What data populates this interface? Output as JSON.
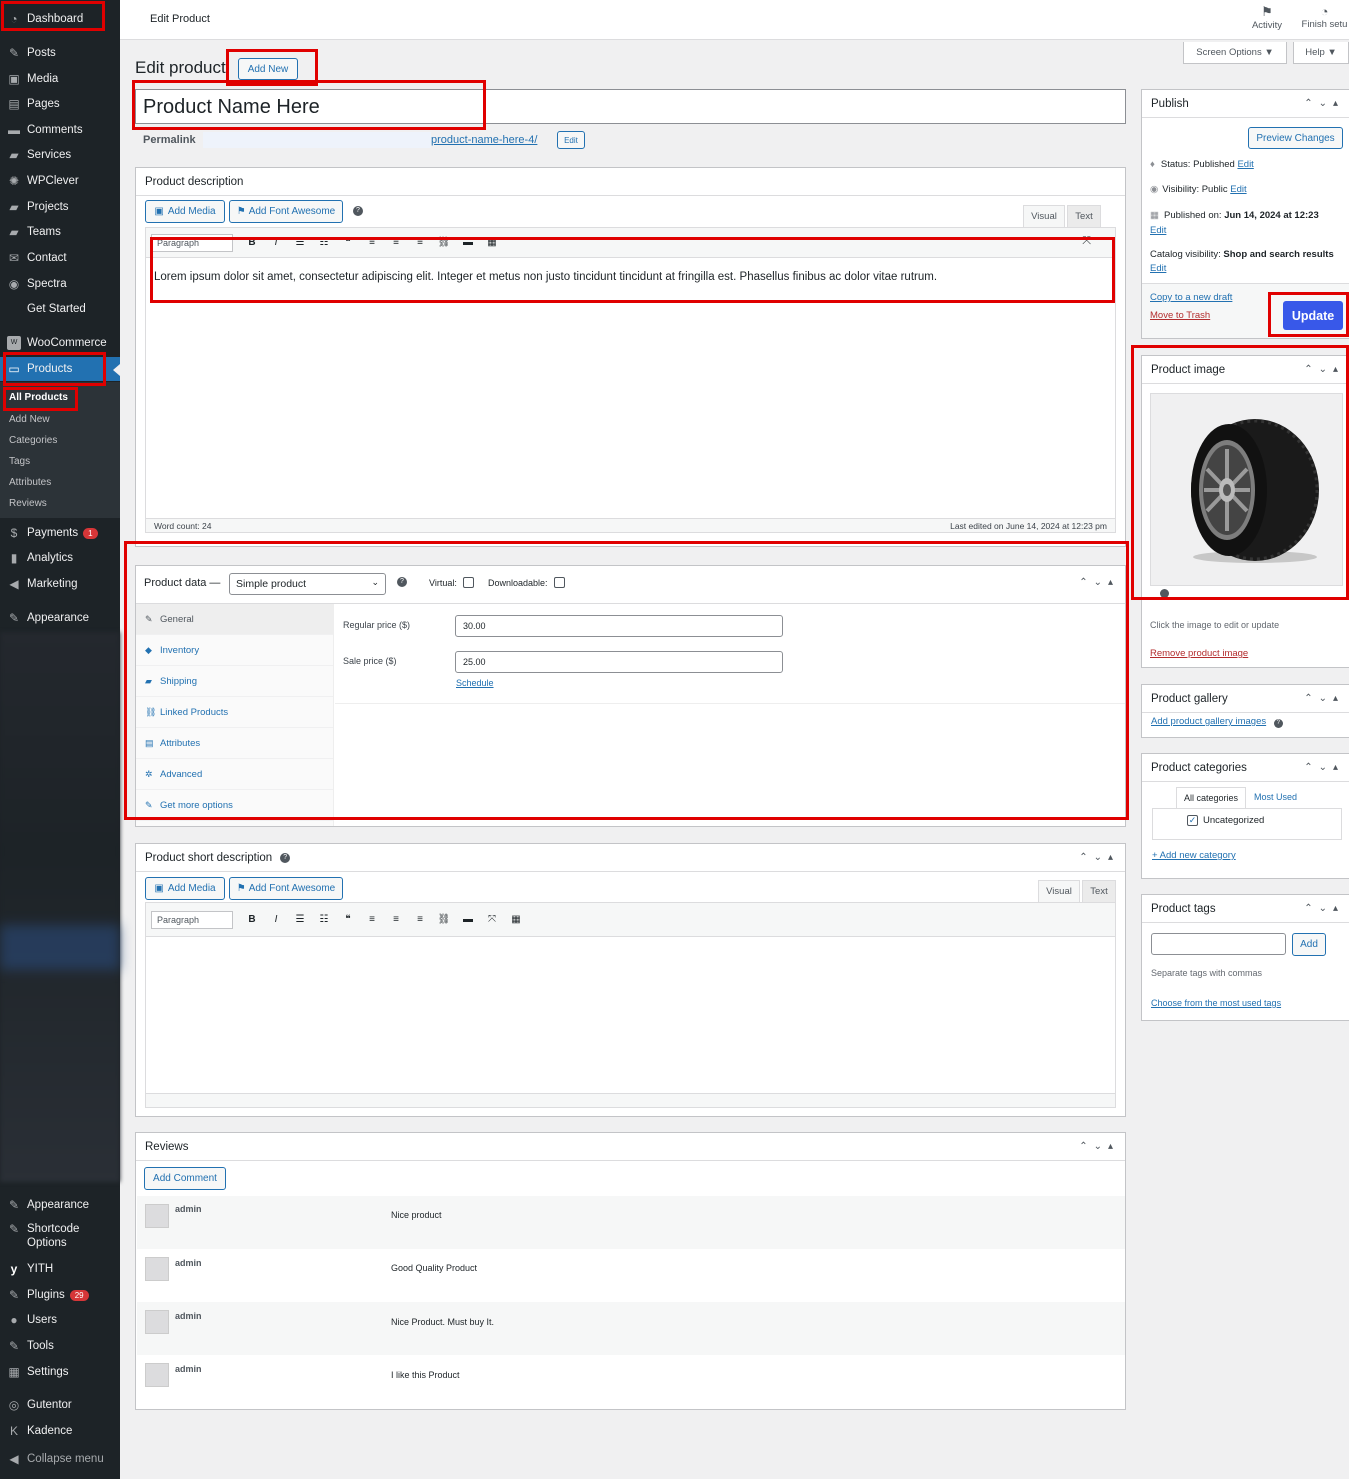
{
  "sidebar": {
    "items": [
      {
        "label": "Dashboard",
        "icon": "dashboard-icon"
      },
      {
        "label": "Posts",
        "icon": "pin-icon"
      },
      {
        "label": "Media",
        "icon": "media-icon"
      },
      {
        "label": "Pages",
        "icon": "pages-icon"
      },
      {
        "label": "Comments",
        "icon": "comment-icon"
      },
      {
        "label": "Services",
        "icon": "folder-icon"
      },
      {
        "label": "WPClever",
        "icon": "wpclever-icon"
      },
      {
        "label": "Projects",
        "icon": "folder-icon"
      },
      {
        "label": "Teams",
        "icon": "folder-icon"
      },
      {
        "label": "Contact",
        "icon": "mail-icon"
      },
      {
        "label": "Spectra",
        "icon": "spectra-icon"
      },
      {
        "label": "Get Started",
        "icon": ""
      },
      {
        "label": "WooCommerce",
        "icon": "woo-icon"
      },
      {
        "label": "Products",
        "icon": "products-icon"
      }
    ],
    "submenu": [
      "All Products",
      "Add New",
      "Categories",
      "Tags",
      "Attributes",
      "Reviews"
    ],
    "items2": [
      {
        "label": "Payments",
        "badge": "1"
      },
      {
        "label": "Analytics"
      },
      {
        "label": "Marketing"
      },
      {
        "label": "Appearance"
      }
    ],
    "items3": [
      {
        "label": "Appearance"
      },
      {
        "label": "Shortcode Options"
      },
      {
        "label": "YITH"
      },
      {
        "label": "Plugins",
        "badge": "29"
      },
      {
        "label": "Users"
      },
      {
        "label": "Tools"
      },
      {
        "label": "Settings"
      },
      {
        "label": "Gutentor"
      },
      {
        "label": "Kadence"
      },
      {
        "label": "Collapse menu"
      }
    ]
  },
  "topbar": {
    "title": "Edit Product",
    "activity": "Activity",
    "finish": "Finish setu"
  },
  "screen_options": "Screen Options ▼",
  "help": "Help ▼",
  "heading": "Edit product",
  "add_new": "Add New",
  "product_title": "Product Name Here",
  "permalink": {
    "label": "Permalink",
    "slug": "product-name-here-4/",
    "edit": "Edit"
  },
  "description": {
    "title": "Product description",
    "add_media": "Add Media",
    "add_fa": "Add Font Awesome",
    "tab_visual": "Visual",
    "tab_text": "Text",
    "format": "Paragraph",
    "content": "Lorem ipsum dolor sit amet, consectetur adipiscing elit. Integer et metus non justo tincidunt tincidunt at fringilla est. Phasellus finibus ac dolor vitae rutrum.",
    "word_count": "Word count: 24",
    "last_edited": "Last edited on June 14, 2024 at 12:23 pm"
  },
  "product_data": {
    "label": "Product data —",
    "type": "Simple product",
    "virtual": "Virtual:",
    "downloadable": "Downloadable:",
    "tabs": [
      "General",
      "Inventory",
      "Shipping",
      "Linked Products",
      "Attributes",
      "Advanced",
      "Get more options"
    ],
    "regular_label": "Regular price ($)",
    "regular_value": "30.00",
    "sale_label": "Sale price ($)",
    "sale_value": "25.00",
    "schedule": "Schedule"
  },
  "short_desc": {
    "title": "Product short description",
    "add_media": "Add Media",
    "add_fa": "Add Font Awesome",
    "tab_visual": "Visual",
    "tab_text": "Text",
    "format": "Paragraph"
  },
  "reviews": {
    "title": "Reviews",
    "add_comment": "Add Comment",
    "rows": [
      {
        "author": "admin",
        "text": "Nice product"
      },
      {
        "author": "admin",
        "text": "Good Quality Product"
      },
      {
        "author": "admin",
        "text": "Nice Product. Must buy It."
      },
      {
        "author": "admin",
        "text": "I like this Product"
      }
    ]
  },
  "publish": {
    "title": "Publish",
    "preview": "Preview Changes",
    "status_label": "Status:",
    "status": "Published",
    "edit": "Edit",
    "visibility_label": "Visibility:",
    "visibility": "Public",
    "published_label": "Published on:",
    "published": "Jun 14, 2024 at 12:23",
    "catalog_label": "Catalog visibility:",
    "catalog": "Shop and search results",
    "copy": "Copy to a new draft",
    "trash": "Move to Trash",
    "update": "Update"
  },
  "product_image": {
    "title": "Product image",
    "hint": "Click the image to edit or update",
    "remove": "Remove product image"
  },
  "gallery": {
    "title": "Product gallery",
    "add": "Add product gallery images"
  },
  "categories": {
    "title": "Product categories",
    "tab_all": "All categories",
    "tab_used": "Most Used",
    "item": "Uncategorized",
    "add": "+ Add new category"
  },
  "tags": {
    "title": "Product tags",
    "add": "Add",
    "hint": "Separate tags with commas",
    "choose": "Choose from the most used tags"
  },
  "colors": {
    "accent": "#2271b1",
    "sidebar": "#1d2327",
    "highlight": "#e00000",
    "update": "#3858e9"
  }
}
